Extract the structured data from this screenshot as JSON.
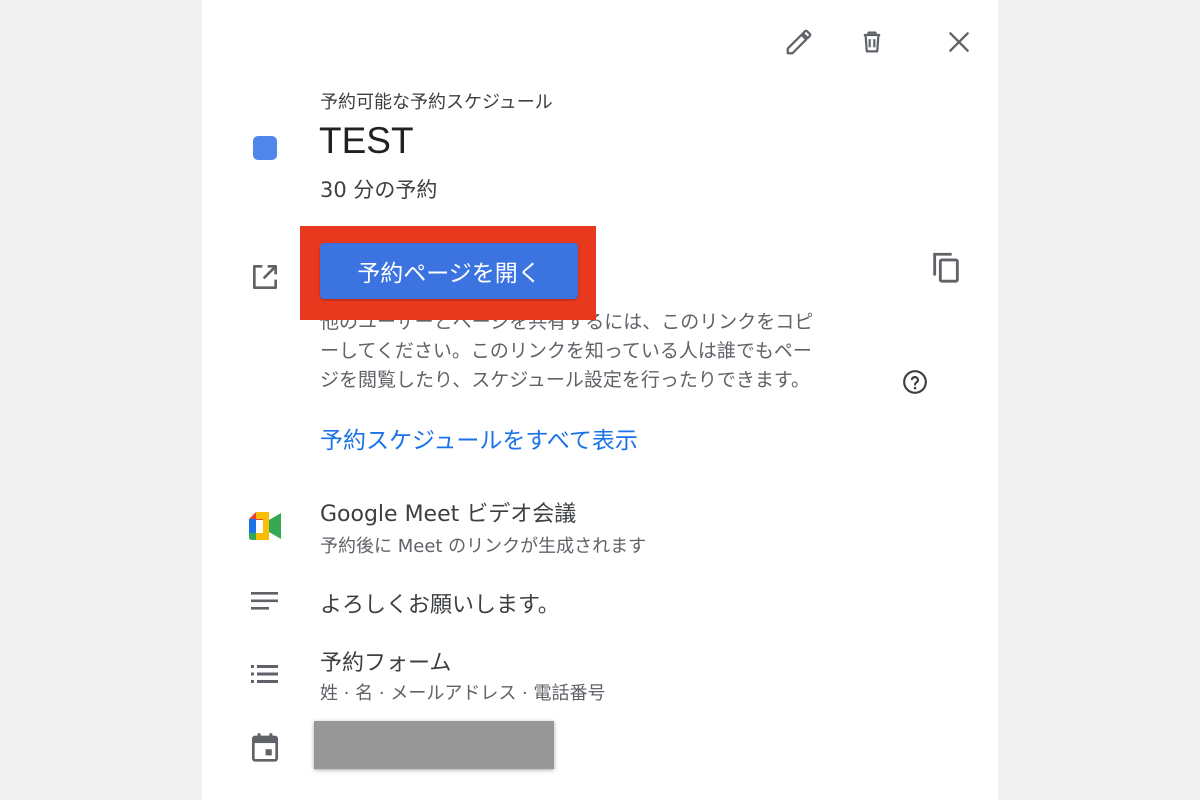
{
  "toolbar": {
    "icons": [
      "pencil-icon",
      "trash-icon",
      "close-icon"
    ]
  },
  "schedule": {
    "eyebrow": "予約可能な予約スケジュール",
    "title": "TEST",
    "duration": "30 分の予約",
    "color": "#4f86ec"
  },
  "booking": {
    "open_button_label": "予約ページを開く",
    "button_color": "#3b74e0",
    "highlight_color": "#e8381e",
    "share_lines": [
      "他のユーザーとページを共有するには、このリンクをコピ",
      "ーしてください。このリンクを知っている人は誰でもペー",
      "ジを閲覧したり、スケジュール設定を行ったりできます。"
    ],
    "view_all_link": "予約スケジュールをすべて表示",
    "link_color": "#1a73e8"
  },
  "meet": {
    "title": "Google Meet ビデオ会議",
    "subtitle": "予約後に Meet のリンクが生成されます"
  },
  "description": {
    "text": "よろしくお願いします。"
  },
  "form": {
    "title": "予約フォーム",
    "fields": "姓 · 名 · メールアドレス · 電話番号"
  }
}
